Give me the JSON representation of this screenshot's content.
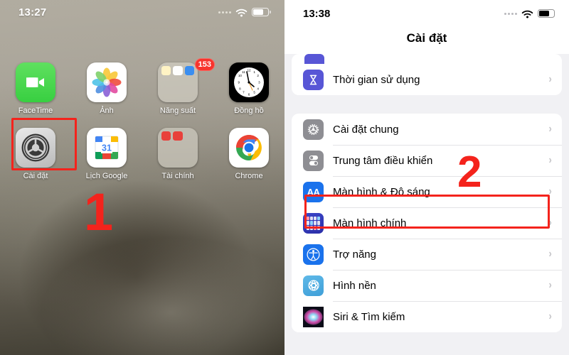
{
  "left_panel": {
    "status_bar": {
      "time": "13:27",
      "signal_icon": "signal-dots-icon",
      "wifi_icon": "wifi-icon",
      "battery_icon": "battery-icon"
    },
    "apps": [
      {
        "label": "FaceTime",
        "icon": "facetime-icon"
      },
      {
        "label": "Ảnh",
        "icon": "photos-icon"
      },
      {
        "label": "Năng suất",
        "icon": "folder-icon",
        "badge": "153"
      },
      {
        "label": "Đồng hồ",
        "icon": "clock-icon"
      },
      {
        "label": "Cài đặt",
        "icon": "settings-gear-icon",
        "highlighted": true
      },
      {
        "label": "Lịch Google",
        "icon": "google-calendar-icon",
        "day": "31"
      },
      {
        "label": "Tài chính",
        "icon": "finance-folder-icon"
      },
      {
        "label": "Chrome",
        "icon": "chrome-icon"
      }
    ],
    "annotation": {
      "marker": "1",
      "color": "#f4231c"
    }
  },
  "right_panel": {
    "status_bar": {
      "time": "13:38",
      "signal_icon": "signal-dots-icon",
      "wifi_icon": "wifi-icon",
      "battery_icon": "battery-icon"
    },
    "nav_title": "Cài đặt",
    "group_one": [
      {
        "label": "Thời gian sử dụng",
        "icon": "hourglass-icon",
        "chevron": "›"
      }
    ],
    "group_two": [
      {
        "label": "Cài đặt chung",
        "icon": "gear-icon",
        "chevron": "›"
      },
      {
        "label": "Trung tâm điều khiển",
        "icon": "toggles-icon",
        "chevron": "›"
      },
      {
        "label": "Màn hình & Độ sáng",
        "icon": "display-aa-icon",
        "icon_text": "AA",
        "chevron": "›",
        "highlighted": true
      },
      {
        "label": "Màn hình chính",
        "icon": "home-screen-icon",
        "chevron": "›"
      },
      {
        "label": "Trợ năng",
        "icon": "accessibility-icon",
        "chevron": "›"
      },
      {
        "label": "Hình nền",
        "icon": "wallpaper-icon",
        "chevron": "›"
      },
      {
        "label": "Siri & Tìm kiếm",
        "icon": "siri-icon",
        "chevron": "›"
      }
    ],
    "annotation": {
      "marker": "2",
      "color": "#f4231c"
    }
  },
  "colors": {
    "accent_red": "#f4231c",
    "ios_blue": "#1a72ec",
    "purple": "#5856d6",
    "gray_icon": "#8e8e93",
    "badge_red": "#f7342d"
  }
}
